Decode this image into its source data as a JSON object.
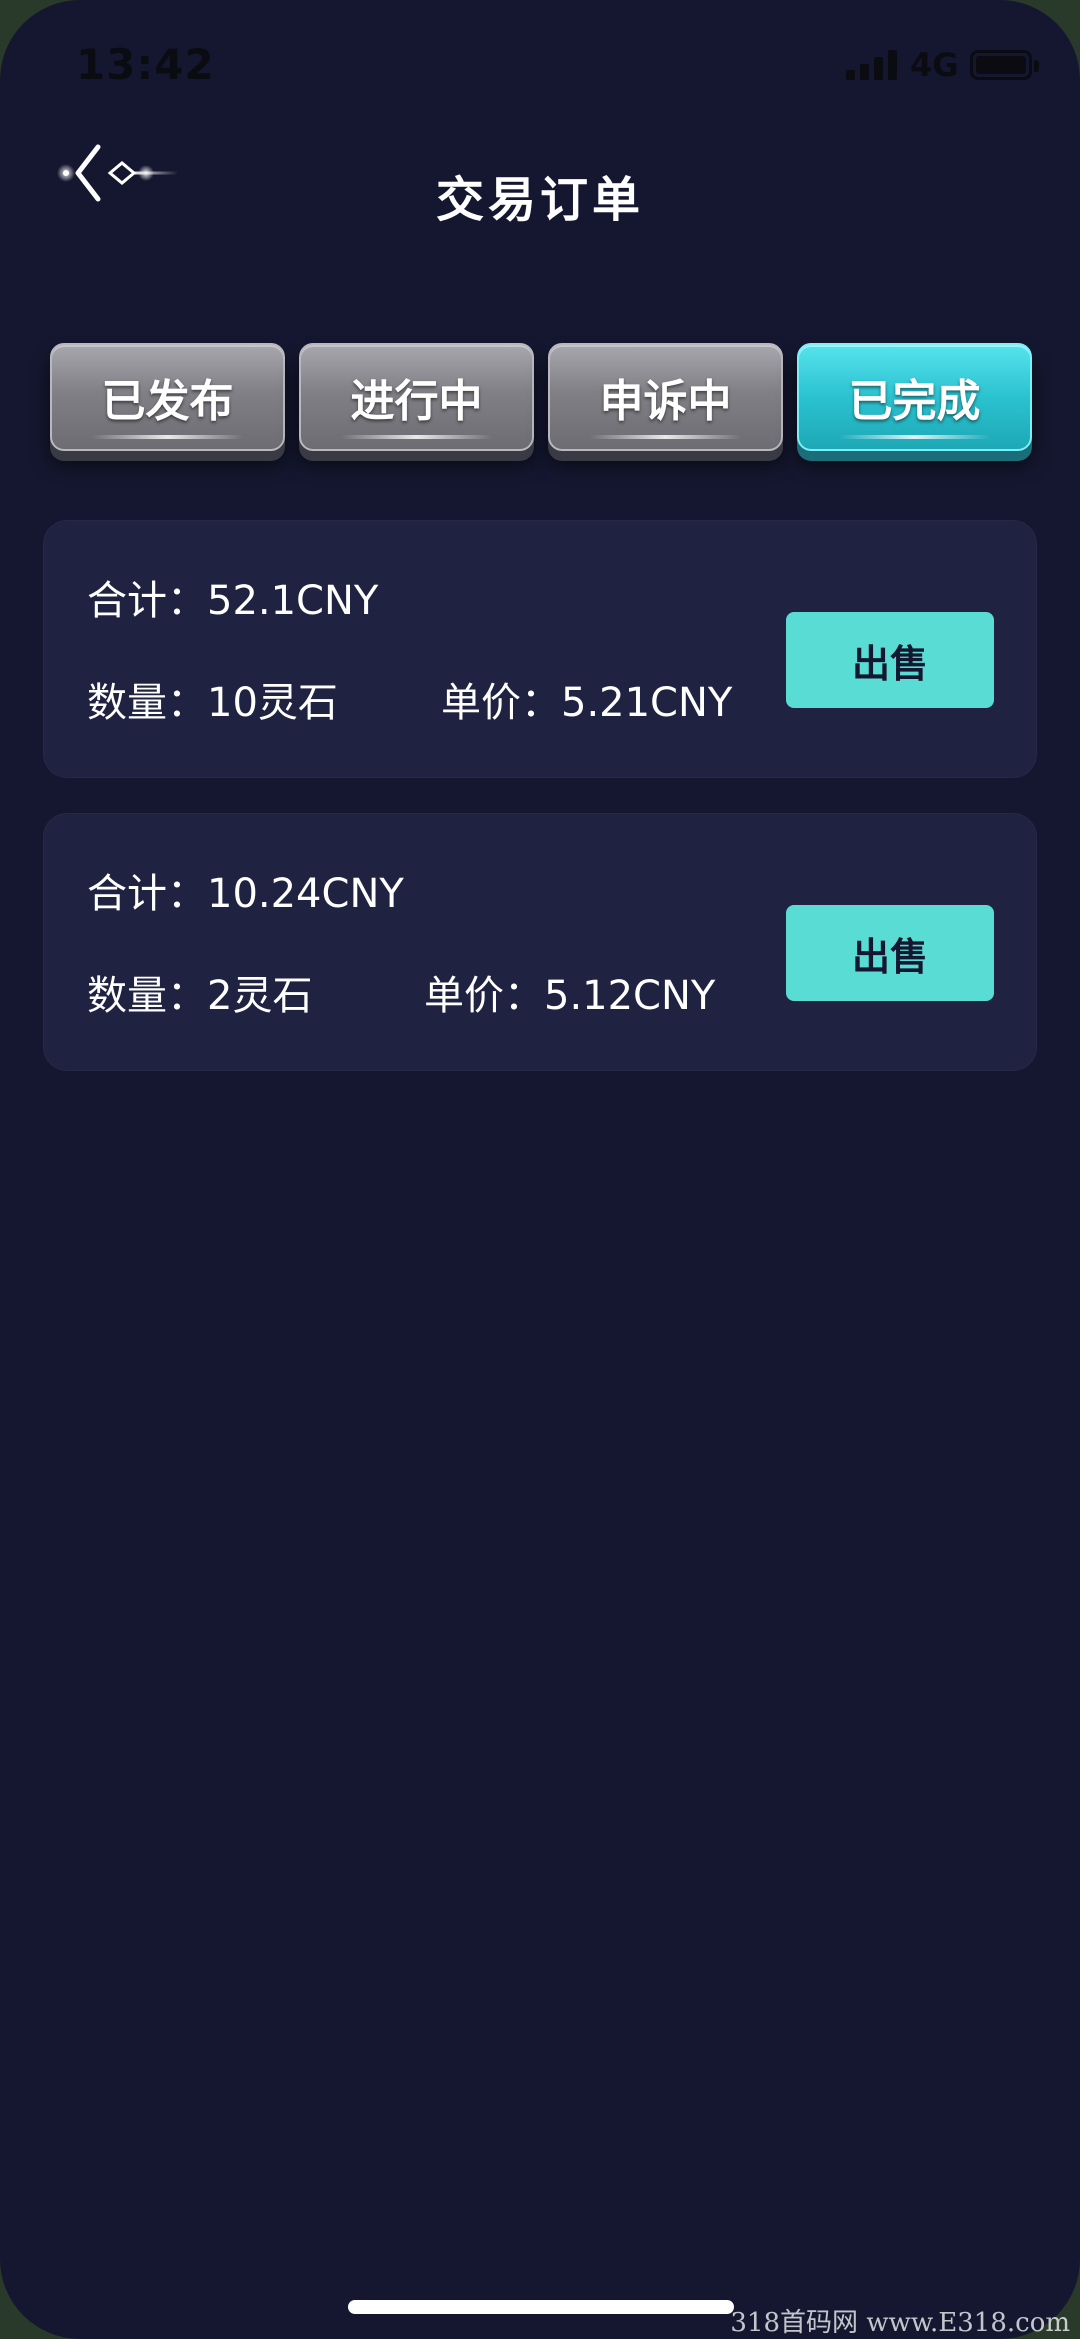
{
  "status_bar": {
    "time": "13:42",
    "network": "4G",
    "signal_icon": "signal-bars-icon",
    "battery_icon": "battery-icon"
  },
  "header": {
    "title": "交易订单",
    "back_icon": "back-arrow-icon"
  },
  "tabs": [
    {
      "label": "已发布",
      "active": false
    },
    {
      "label": "进行中",
      "active": false
    },
    {
      "label": "申诉中",
      "active": false
    },
    {
      "label": "已完成",
      "active": true
    }
  ],
  "orders": [
    {
      "total": "合计：52.1CNY",
      "quantity": "数量：10灵石",
      "unit_price": "单价：5.21CNY",
      "action_label": "出售"
    },
    {
      "total": "合计：10.24CNY",
      "quantity": "数量：2灵石",
      "unit_price": "单价：5.12CNY",
      "action_label": "出售"
    }
  ],
  "watermark": "318首码网 www.E318.com",
  "colors": {
    "background": "#151730",
    "card": "#1f2240",
    "accent": "#58dcd4",
    "tab_active": "#2bc2d0",
    "tab_inactive": "#808086"
  }
}
